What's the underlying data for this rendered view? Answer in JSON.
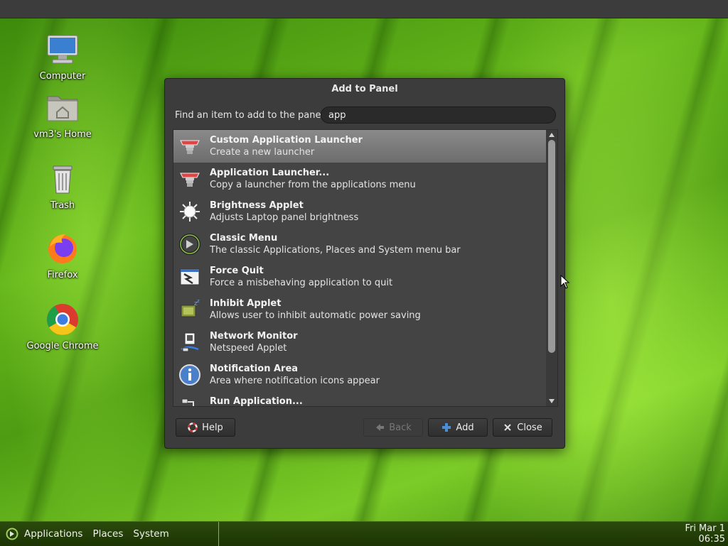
{
  "desktop": {
    "icons": [
      {
        "label": "Computer"
      },
      {
        "label": "vm3's Home"
      },
      {
        "label": "Trash"
      },
      {
        "label": "Firefox"
      },
      {
        "label": "Google Chrome"
      }
    ]
  },
  "panel": {
    "menu": {
      "applications": "Applications",
      "places": "Places",
      "system": "System"
    },
    "clock": {
      "date": "Fri Mar 1",
      "time": "06:35"
    }
  },
  "dialog": {
    "title": "Add to Panel",
    "find_label": "Find an item to add to the panel:",
    "search_value": "app",
    "items": [
      {
        "name": "Custom Application Launcher",
        "desc": "Create a new launcher",
        "icon": "launcher-icon"
      },
      {
        "name": "Application Launcher...",
        "desc": "Copy a launcher from the applications menu",
        "icon": "launcher-icon"
      },
      {
        "name": "Brightness Applet",
        "desc": "Adjusts Laptop panel brightness",
        "icon": "sun-icon"
      },
      {
        "name": "Classic Menu",
        "desc": "The classic Applications, Places and System menu bar",
        "icon": "mate-menu-icon"
      },
      {
        "name": "Force Quit",
        "desc": "Force a misbehaving application to quit",
        "icon": "force-quit-icon"
      },
      {
        "name": "Inhibit Applet",
        "desc": "Allows user to inhibit automatic power saving",
        "icon": "inhibit-icon"
      },
      {
        "name": "Network Monitor",
        "desc": "Netspeed Applet",
        "icon": "network-icon"
      },
      {
        "name": "Notification Area",
        "desc": "Area where notification icons appear",
        "icon": "info-icon"
      },
      {
        "name": "Run Application...",
        "desc": "",
        "icon": "run-icon"
      }
    ],
    "buttons": {
      "help": "Help",
      "back": "Back",
      "add": "Add",
      "close": "Close"
    }
  },
  "colors": {
    "accent_selected": "#7c7c7c",
    "panel_bottom": "#1f3a05",
    "add_icon": "#4a8fd6"
  }
}
